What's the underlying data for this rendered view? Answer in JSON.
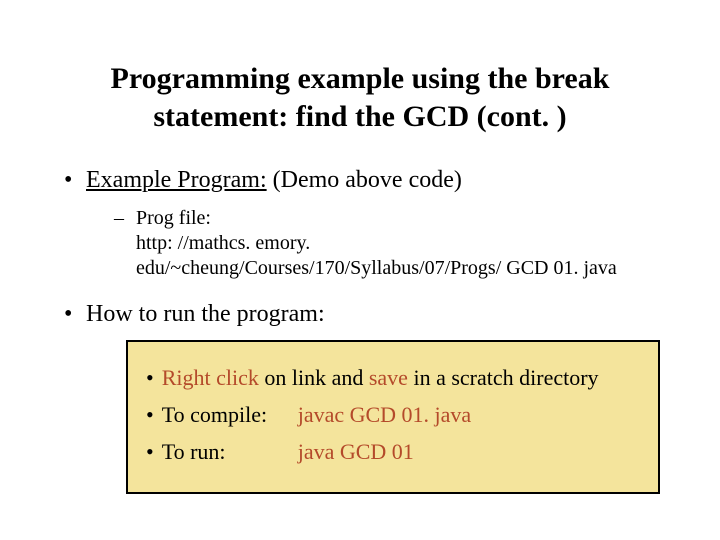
{
  "title_line1": "Programming example using the break",
  "title_line2": "statement: find the GCD (cont. )",
  "bullet1_prefix": "Example Program:",
  "bullet1_suffix": " (Demo above code)",
  "sub1_label": "Prog file:",
  "sub1_url": "http: //mathcs. emory. edu/~cheung/Courses/170/Syllabus/07/Progs/ GCD 01. java",
  "bullet2": "How to run the program:",
  "box": {
    "row1_a": "Right click",
    "row1_b": " on link and ",
    "row1_c": "save",
    "row1_d": " in a scratch directory",
    "row2_label": "To compile:",
    "row2_cmd": "javac GCD 01. java",
    "row3_label": "To run:",
    "row3_cmd": "java GCD 01"
  }
}
